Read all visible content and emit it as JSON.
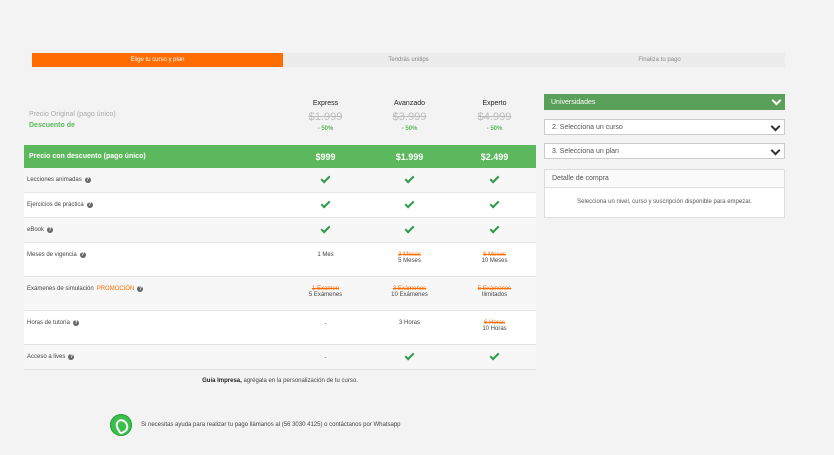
{
  "steps": [
    {
      "label": "Elige tu curso y plan",
      "active": true
    },
    {
      "label": "Tendrás unitips",
      "active": false
    },
    {
      "label": "Finaliza tu pago",
      "active": false
    }
  ],
  "pricing": {
    "original_label": "Precio Original (pago único)",
    "discount_label": "Descuento de",
    "discounted_label": "Precio con descuento (pago único)",
    "plans": [
      {
        "name": "Express",
        "original": "$1.999",
        "discount": "- 50%",
        "price": "$999"
      },
      {
        "name": "Avanzado",
        "original": "$3.999",
        "discount": "- 50%",
        "price": "$1.999"
      },
      {
        "name": "Experto",
        "original": "$4.999",
        "discount": "- 50%",
        "price": "$2.499"
      }
    ]
  },
  "features": [
    {
      "label": "Lecciones animadas",
      "promo": "",
      "cells": [
        {
          "check": true
        },
        {
          "check": true
        },
        {
          "check": true
        }
      ]
    },
    {
      "label": "Ejercicios de práctica",
      "promo": "",
      "cells": [
        {
          "check": true
        },
        {
          "check": true
        },
        {
          "check": true
        }
      ]
    },
    {
      "label": "eBook",
      "promo": "",
      "cells": [
        {
          "check": true
        },
        {
          "check": true
        },
        {
          "check": true
        }
      ]
    },
    {
      "label": "Meses de vigencia",
      "promo": "",
      "cells": [
        {
          "strike": "",
          "value": "1 Mes"
        },
        {
          "strike": "3 Meses",
          "value": "5 Meses"
        },
        {
          "strike": "6 Meses",
          "value": "10 Meses"
        }
      ]
    },
    {
      "label": "Exámenes de simulación",
      "promo": "PROMOCIÓN",
      "cells": [
        {
          "strike": "1 Examen",
          "value": "5 Exámenes"
        },
        {
          "strike": "3 Exámenes",
          "value": "10 Exámenes"
        },
        {
          "strike": "5 Exámenes",
          "value": "Ilimitados"
        }
      ]
    },
    {
      "label": "Horas de tutoría",
      "promo": "",
      "cells": [
        {
          "strike": "",
          "value": "-"
        },
        {
          "strike": "",
          "value": "3 Horas"
        },
        {
          "strike": "6 Horas",
          "value": "10 Horas"
        }
      ]
    },
    {
      "label": "Acceso a lives",
      "promo": "",
      "cells": [
        {
          "strike": "",
          "value": "-"
        },
        {
          "check": true
        },
        {
          "check": true
        }
      ]
    }
  ],
  "note": {
    "bold": "Guía Impresa,",
    "text": " agrégala en la personalización de tu curso."
  },
  "sidebar": {
    "university": "Universidades",
    "course": "2. Selecciona un curso",
    "plan": "3. Selecciona un plan",
    "detail_title": "Detalle de compra",
    "detail_msg": "Selecciona un nivel, curso y suscripción disponible para empezar."
  },
  "help": {
    "text": "Si necesitas ayuda para realizar tu pago llámanos al (56 3030 4125) o contáctanos por Whatsapp"
  },
  "colors": {
    "accent": "#ff6c00",
    "green": "#5cb85c",
    "check": "#2e9a4a"
  }
}
